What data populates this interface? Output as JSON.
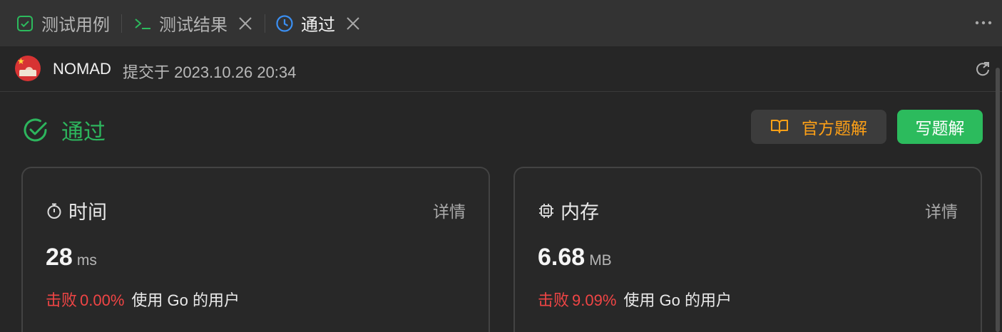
{
  "tabs": [
    {
      "label": "测试用例",
      "icon": "checkbox-icon",
      "color": "#2cbb5d"
    },
    {
      "label": "测试结果",
      "icon": "terminal-icon",
      "color": "#2cbb5d"
    },
    {
      "label": "通过",
      "icon": "clock-icon",
      "color": "#3b8ff2"
    }
  ],
  "submission": {
    "user": "NOMAD",
    "submitted_text": "提交于 2023.10.26 20:34"
  },
  "status": {
    "text": "通过",
    "color": "#2db55d"
  },
  "buttons": {
    "official_solution": "官方题解",
    "write_solution": "写题解"
  },
  "time_card": {
    "title": "时间",
    "detail": "详情",
    "value": "28",
    "unit": "ms",
    "beats_label": "击败",
    "beats_percent": "0.00%",
    "beats_suffix": "使用 Go 的用户"
  },
  "memory_card": {
    "title": "内存",
    "detail": "详情",
    "value": "6.68",
    "unit": "MB",
    "beats_label": "击败",
    "beats_percent": "9.09%",
    "beats_suffix": "使用 Go 的用户"
  }
}
